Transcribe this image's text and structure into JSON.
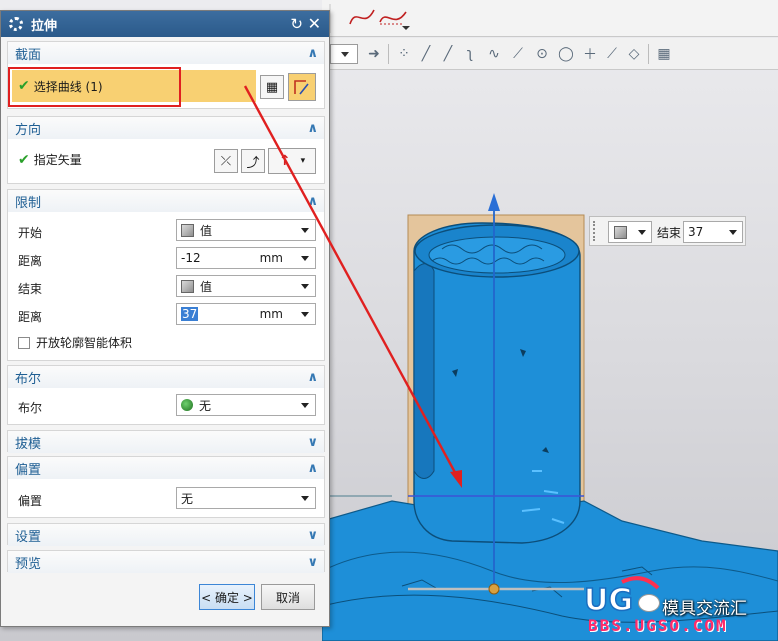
{
  "dialog": {
    "title": "拉伸",
    "sections": {
      "section": {
        "title": "截面",
        "select_curve": "选择曲线 (1)"
      },
      "direction": {
        "title": "方向",
        "specify_vector": "指定矢量"
      },
      "limits": {
        "title": "限制",
        "start_label": "开始",
        "start_value": "值",
        "start_distance_label": "距离",
        "start_distance": "-12",
        "end_label": "结束",
        "end_value": "值",
        "end_distance_label": "距离",
        "end_distance": "37",
        "unit": "mm",
        "open_profile": "开放轮廓智能体积"
      },
      "boolean": {
        "title": "布尔",
        "label": "布尔",
        "value": "无"
      },
      "draft": {
        "title": "拔模"
      },
      "offset": {
        "title": "偏置",
        "label": "偏置",
        "value": "无"
      },
      "settings": {
        "title": "设置"
      },
      "preview": {
        "title": "预览"
      }
    },
    "buttons": {
      "ok": "< 确定 >",
      "cancel": "取消"
    }
  },
  "floating_input": {
    "label": "结束",
    "value": "37"
  },
  "watermark": {
    "forum_name": "模具交流汇",
    "site": "BBS.UGSO.COM"
  },
  "colors": {
    "titlebar": "#2b5a8a",
    "section_header_text": "#1f5f94",
    "highlight_row": "#f8d072",
    "model_blue": "#1e8fd8",
    "annotation_red": "#e02020"
  },
  "icons": {
    "title": "gear-icon",
    "reset": "reset-icon",
    "close": "close-icon"
  }
}
